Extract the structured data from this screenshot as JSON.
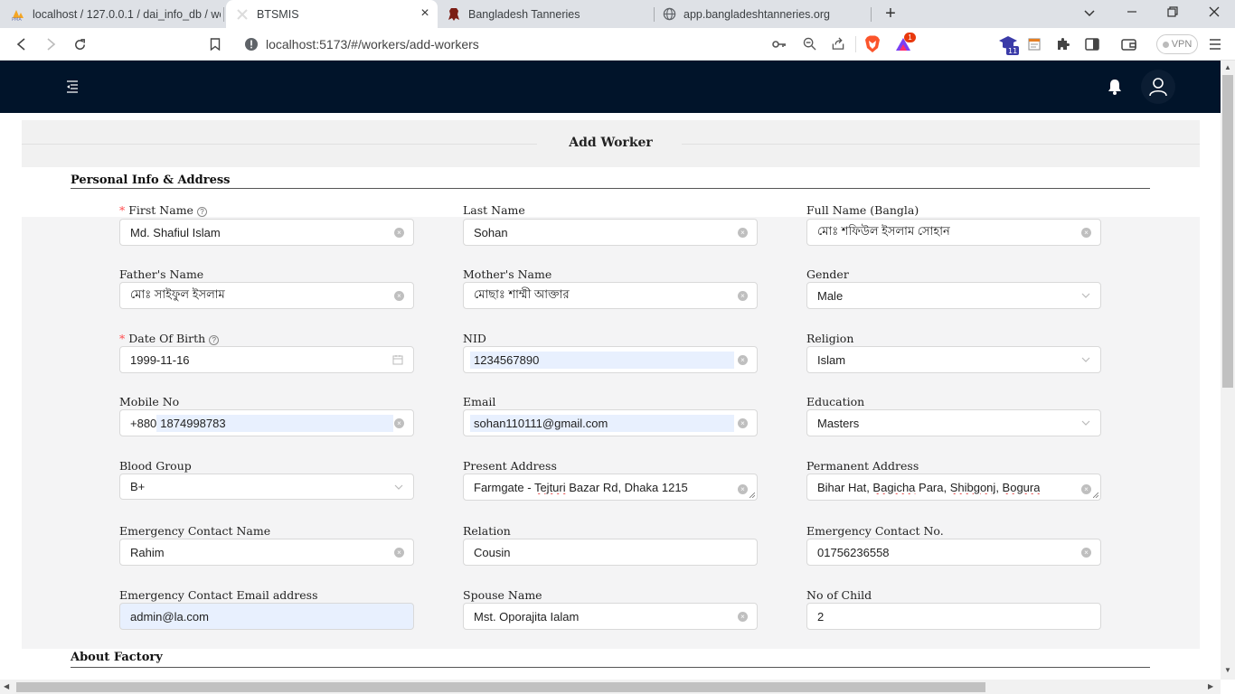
{
  "browser": {
    "tabs": [
      {
        "title": "localhost / 127.0.0.1 / dai_info_db / wo",
        "active": false,
        "icon": "phpmyadmin-icon"
      },
      {
        "title": "BTSMIS",
        "active": true,
        "icon": "blank-page-icon"
      },
      {
        "title": "Bangladesh Tanneries",
        "active": false,
        "icon": "hide-leather-icon"
      },
      {
        "title": "app.bangladeshtanneries.org",
        "active": false,
        "icon": "globe-icon"
      }
    ],
    "url": "localhost:5173/#/workers/add-workers",
    "vpn_label": "VPN",
    "badge_count": "1",
    "ext_count": "11"
  },
  "page": {
    "title": "Add Worker",
    "section_personal": "Personal Info & Address",
    "section_factory": "About Factory"
  },
  "form": {
    "first_name": {
      "label": "First Name",
      "value": "Md. Shafiul Islam"
    },
    "last_name": {
      "label": "Last Name",
      "value": "Sohan"
    },
    "full_name_bangla": {
      "label": "Full Name (Bangla)",
      "value": "মোঃ শফিউল ইসলাম সোহান"
    },
    "fathers_name": {
      "label": "Father's Name",
      "value": "মোঃ সাইফুল ইসলাম"
    },
    "mothers_name": {
      "label": "Mother's Name",
      "value": "মোছাঃ শাম্মী আক্তার"
    },
    "gender": {
      "label": "Gender",
      "value": "Male"
    },
    "dob": {
      "label": "Date Of Birth",
      "value": "1999-11-16"
    },
    "nid": {
      "label": "NID",
      "value": "1234567890"
    },
    "religion": {
      "label": "Religion",
      "value": "Islam"
    },
    "mobile": {
      "label": "Mobile No",
      "prefix": "+880",
      "value": "1874998783"
    },
    "email": {
      "label": "Email",
      "value": "sohan110111@gmail.com"
    },
    "education": {
      "label": "Education",
      "value": "Masters"
    },
    "blood_group": {
      "label": "Blood Group",
      "value": "B+"
    },
    "present_address": {
      "label": "Present Address",
      "value_parts": [
        "Farmgate - ",
        "Tejturi",
        " Bazar Rd, Dhaka 1215"
      ]
    },
    "permanent_address": {
      "label": "Permanent Address",
      "value_parts": [
        "Bihar Hat, ",
        "Bagicha",
        " Para, ",
        "Shibgonj",
        ", ",
        "Bogura"
      ]
    },
    "emergency_name": {
      "label": "Emergency Contact Name",
      "value": "Rahim"
    },
    "relation": {
      "label": "Relation",
      "value": "Cousin"
    },
    "emergency_no": {
      "label": "Emergency Contact No.",
      "value": "01756236558"
    },
    "emergency_email": {
      "label": "Emergency Contact Email address",
      "value": "admin@la.com"
    },
    "spouse_name": {
      "label": "Spouse Name",
      "value": "Mst. Oporajita Ialam"
    },
    "no_of_child": {
      "label": "No of Child",
      "value": "2"
    }
  }
}
